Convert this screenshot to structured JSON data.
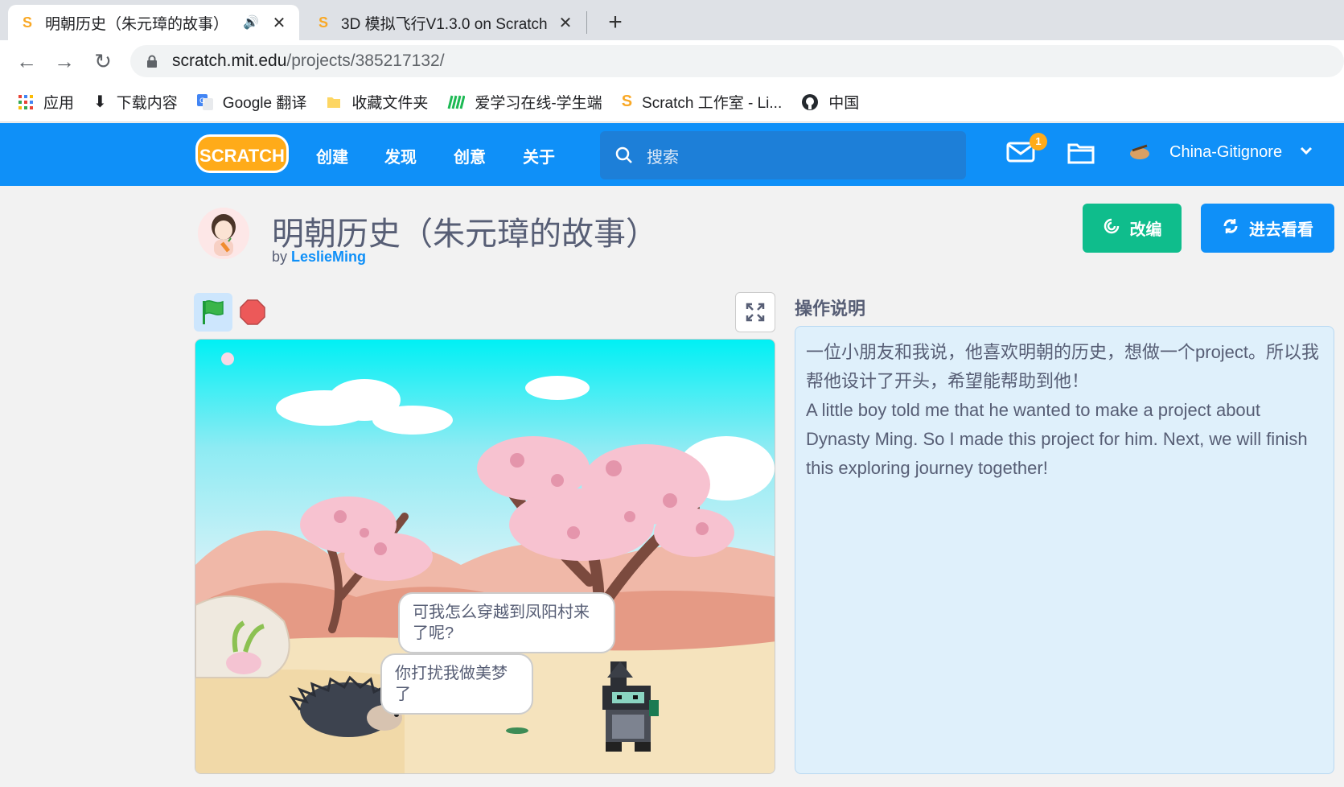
{
  "browser": {
    "tabs": [
      {
        "title": "明朝历史（朱元璋的故事）",
        "active": true,
        "audio": true
      },
      {
        "title": "3D 模拟飞行V1.3.0 on Scratch",
        "active": false
      }
    ],
    "url_host": "scratch.mit.edu",
    "url_path": "/projects/385217132/",
    "bookmarks": [
      {
        "label": "应用",
        "icon": "apps-grid-icon"
      },
      {
        "label": "下载内容",
        "icon": "download-icon"
      },
      {
        "label": "Google 翻译",
        "icon": "google-translate-icon"
      },
      {
        "label": "收藏文件夹",
        "icon": "folder-icon"
      },
      {
        "label": "爱学习在线-学生端",
        "icon": "aixuexi-icon"
      },
      {
        "label": "Scratch 工作室 - Li...",
        "icon": "scratch-icon"
      },
      {
        "label": "中国",
        "icon": "github-icon"
      }
    ]
  },
  "scratch_nav": {
    "logo": "SCRATCH",
    "links": [
      "创建",
      "发现",
      "创意",
      "关于"
    ],
    "search_placeholder": "搜索",
    "message_count": "1",
    "username": "China-Gitignore"
  },
  "project": {
    "title": "明朝历史（朱元璋的故事）",
    "by_label": "by",
    "author": "LeslieMing",
    "remix_label": "改编",
    "see_inside_label": "进去看看",
    "stage_bubbles": [
      "可我怎么穿越到凤阳村来了呢?",
      "你打扰我做美梦了"
    ]
  },
  "instructions": {
    "heading": "操作说明",
    "text": "一位小朋友和我说，他喜欢明朝的历史，想做一个project。所以我帮他设计了开头，希望能帮助到他！\nA little boy told me that he wanted to make a project about Dynasty Ming. So I made this project for him. Next, we will finish this exploring journey together!"
  },
  "colors": {
    "scratch_blue": "#0f90f8",
    "remix_green": "#0fbd8c",
    "logo_orange": "#ffab19",
    "instructions_bg": "#dff0fb"
  }
}
